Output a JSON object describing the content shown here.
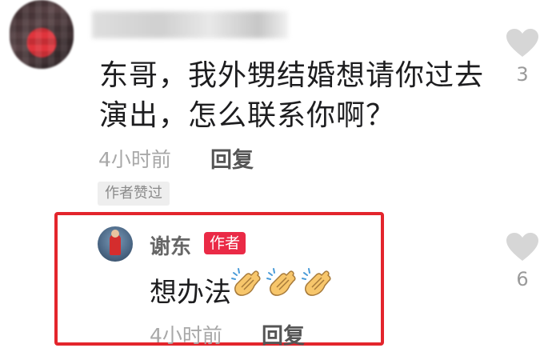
{
  "comment": {
    "text": "东哥，我外甥结婚想请你过去演出，怎么联系你啊？",
    "time": "4小时前",
    "reply_label": "回复",
    "liked_badge": "作者赞过",
    "likes": "3"
  },
  "reply": {
    "author": "谢东",
    "author_badge": "作者",
    "text": "想办法",
    "emojis": [
      "clapping-hands",
      "clapping-hands",
      "clapping-hands"
    ],
    "time": "4小时前",
    "reply_label": "回复",
    "likes": "6"
  },
  "colors": {
    "highlight_border": "#e3252c",
    "author_badge_bg": "#ea2a46",
    "heart": "#d6d6d6"
  }
}
